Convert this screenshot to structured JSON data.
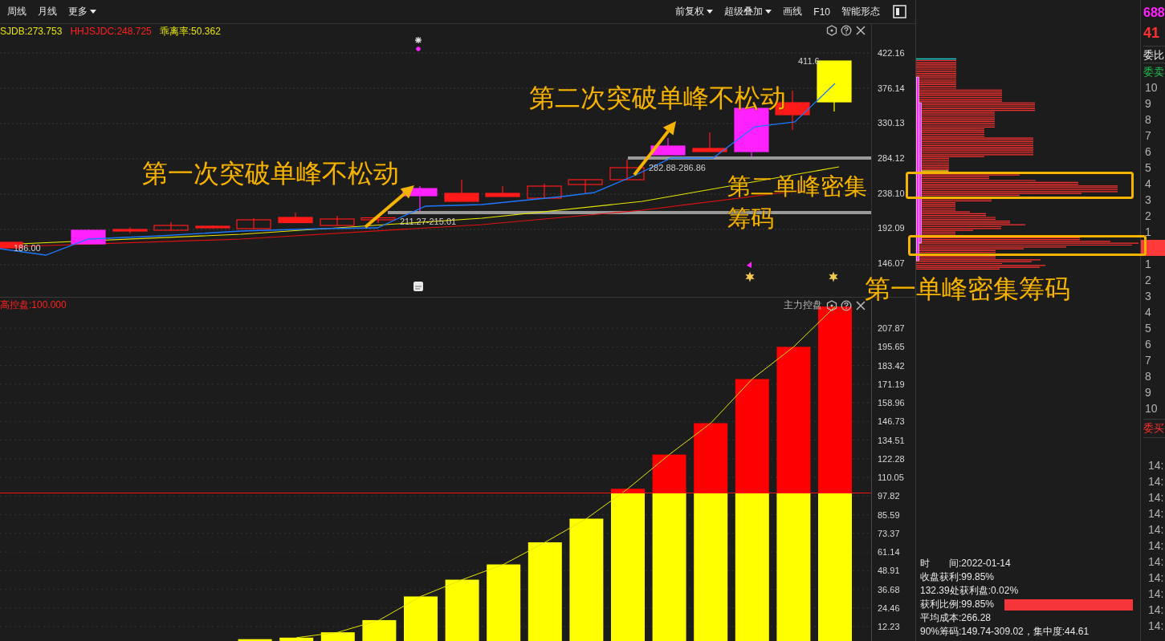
{
  "toolbar": {
    "left": [
      {
        "label": "周线",
        "kind": "button"
      },
      {
        "label": "月线",
        "kind": "button"
      },
      {
        "label": "更多",
        "kind": "dropdown"
      }
    ],
    "right": [
      {
        "label": "前复权",
        "kind": "dropdown"
      },
      {
        "label": "超级叠加",
        "kind": "dropdown"
      },
      {
        "label": "画线",
        "kind": "button"
      },
      {
        "label": "F10",
        "kind": "button"
      },
      {
        "label": "智能形态",
        "kind": "button"
      }
    ]
  },
  "price_panel": {
    "legend": [
      {
        "text": "SJDB:273.753",
        "color": "#e6e600"
      },
      {
        "text": "HHJSJDC:248.725",
        "color": "#ff2020"
      },
      {
        "text": "乖离率:50.362",
        "color": "#e6e600"
      }
    ],
    "axis_labels": [
      "422.16",
      "376.14",
      "330.13",
      "284.12",
      "238.10",
      "192.09",
      "146.07"
    ],
    "price_labels": [
      "186.00",
      "211.27-215.01",
      "282.88-286.86",
      "411.6"
    ]
  },
  "control_panel": {
    "legend": "高控盘:100.000",
    "title": "主力控盘",
    "chart_data": {
      "type": "bar",
      "stacked": true,
      "grid": true,
      "ylim": [
        2.8,
        226.3
      ],
      "yticks": [
        207.87,
        195.65,
        183.42,
        171.19,
        158.96,
        146.73,
        134.51,
        122.28,
        110.05,
        97.82,
        85.59,
        73.37,
        61.14,
        48.91,
        36.68,
        24.46,
        12.23
      ],
      "series": [
        {
          "color": "#ffff00",
          "values": [
            4,
            5,
            8.5,
            16.5,
            32,
            43,
            53,
            67.5,
            83,
            99.6,
            100,
            100,
            100,
            100,
            100
          ]
        },
        {
          "color": "#ff0000",
          "values": [
            null,
            null,
            null,
            null,
            null,
            null,
            null,
            null,
            null,
            3,
            25,
            45.6,
            74.5,
            95.6,
            122
          ]
        },
        {
          "type": "line",
          "color": "#e6e600",
          "values": [
            null,
            5,
            8.5,
            16.5,
            32,
            43,
            53,
            67.5,
            83,
            102.6,
            125,
            145.6,
            174.5,
            195.6,
            222
          ]
        }
      ]
    }
  },
  "annotations": [
    {
      "text": "第一次突破单峰不松动"
    },
    {
      "text": "第二次突破单峰不松动"
    },
    {
      "text": "第二单峰密集筹码"
    },
    {
      "text": "第一单峰密集筹码"
    }
  ],
  "chip_info": [
    {
      "kind": "text",
      "text": "时　　间:2022-01-14"
    },
    {
      "kind": "text",
      "text": "收盘获利:99.85%"
    },
    {
      "kind": "text",
      "text": "132.39处获利盘:0.02%"
    },
    {
      "kind": "ratio",
      "text": "获利比例:99.85%",
      "level": 0.9985
    },
    {
      "kind": "text",
      "text": "平均成本:266.28"
    },
    {
      "kind": "text",
      "text": "90%筹码:149.74-309.02，集中度:44.61"
    }
  ],
  "order_book": {
    "code": "688",
    "price": "41",
    "ratio_label": "委比",
    "ask_label": "委卖",
    "asks": [
      "10",
      "9",
      "8",
      "7",
      "6",
      "5",
      "4",
      "3",
      "2",
      "1"
    ],
    "bids": [
      "1",
      "2",
      "3",
      "4",
      "5",
      "6",
      "7",
      "8",
      "9",
      "10"
    ],
    "bid_label": "委买",
    "times": [
      "14:",
      "14:",
      "14:",
      "14:",
      "14:",
      "14:",
      "14:",
      "14:",
      "14:",
      "14:",
      "14:"
    ]
  }
}
